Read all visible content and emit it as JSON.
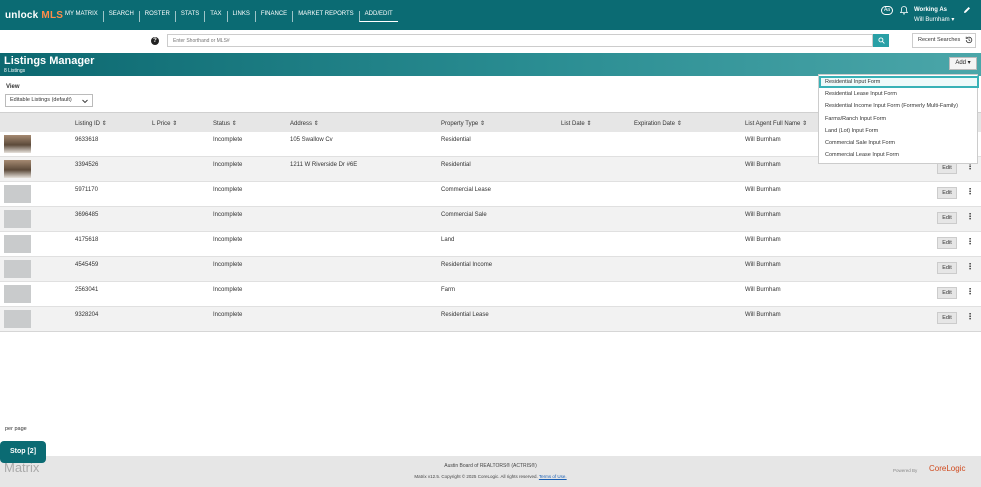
{
  "topbar": {
    "logo_prefix": "unlock",
    "logo_suffix": "MLS",
    "nav": [
      "MY MATRIX",
      "SEARCH",
      "ROSTER",
      "STATS",
      "TAX",
      "LINKS",
      "FINANCE",
      "MARKET REPORTS",
      "ADD/EDIT"
    ],
    "aa_label": "Aa",
    "working_label": "Working As",
    "working_user": "Will Burnham ▾"
  },
  "search": {
    "placeholder": "Enter Shorthand or MLS#",
    "recent_label": "Recent Searches"
  },
  "header": {
    "title": "Listings Manager",
    "count": "8 Listings",
    "add_label": "Add ▾"
  },
  "view": {
    "label": "View",
    "selected": "Editable Listings (default)"
  },
  "table": {
    "columns": [
      "Listing ID ⇕",
      "L Price ⇕",
      "Status ⇕",
      "Address ⇕",
      "Property Type ⇕",
      "List Date ⇕",
      "Expiration Date ⇕",
      "List Agent Full Name ⇕"
    ],
    "rows": [
      {
        "id": "9633618",
        "status": "Incomplete",
        "address": "105 Swallow Cv",
        "type": "Residential",
        "agent": "Will Burnham",
        "photo": "house"
      },
      {
        "id": "3394526",
        "status": "Incomplete",
        "address": "1211 W Riverside Dr #6E",
        "type": "Residential",
        "agent": "Will Burnham",
        "photo": "house"
      },
      {
        "id": "5971170",
        "status": "Incomplete",
        "address": "",
        "type": "Commercial Lease",
        "agent": "Will Burnham",
        "photo": "placeholder"
      },
      {
        "id": "3696485",
        "status": "Incomplete",
        "address": "",
        "type": "Commercial Sale",
        "agent": "Will Burnham",
        "photo": "placeholder"
      },
      {
        "id": "4175618",
        "status": "Incomplete",
        "address": "",
        "type": "Land",
        "agent": "Will Burnham",
        "photo": "placeholder"
      },
      {
        "id": "4545459",
        "status": "Incomplete",
        "address": "",
        "type": "Residential Income",
        "agent": "Will Burnham",
        "photo": "placeholder"
      },
      {
        "id": "2563041",
        "status": "Incomplete",
        "address": "",
        "type": "Farm",
        "agent": "Will Burnham",
        "photo": "placeholder"
      },
      {
        "id": "9328204",
        "status": "Incomplete",
        "address": "",
        "type": "Residential Lease",
        "agent": "Will Burnham",
        "photo": "placeholder"
      }
    ],
    "edit_label": "Edit",
    "kebab": "⋮"
  },
  "add_menu": [
    "Residential Input Form",
    "Residential Lease Input Form",
    "Residential Income Input Form (Formerly Multi-Family)",
    "Farms/Ranch Input Form",
    "Land (Lot) Input Form",
    "Commercial Sale Input Form",
    "Commercial Lease Input Form"
  ],
  "bottom": {
    "per_page": "per page",
    "stop_label": "Stop [2]"
  },
  "footer": {
    "matrix": "Matrix",
    "line1": "Austin Board of REALTORS® (ACTRIS®)",
    "line2_prefix": "Matrix v12.5. Copyright © 2025 CoreLogic. All rights reserved.",
    "terms": "Terms of Use.",
    "powered": "Powered By",
    "corelogic": "CoreLogic"
  },
  "colors": {
    "nav_bg": "#0b6b73",
    "accent": "#29a0a6",
    "logo_accent": "#ff8c4a"
  }
}
